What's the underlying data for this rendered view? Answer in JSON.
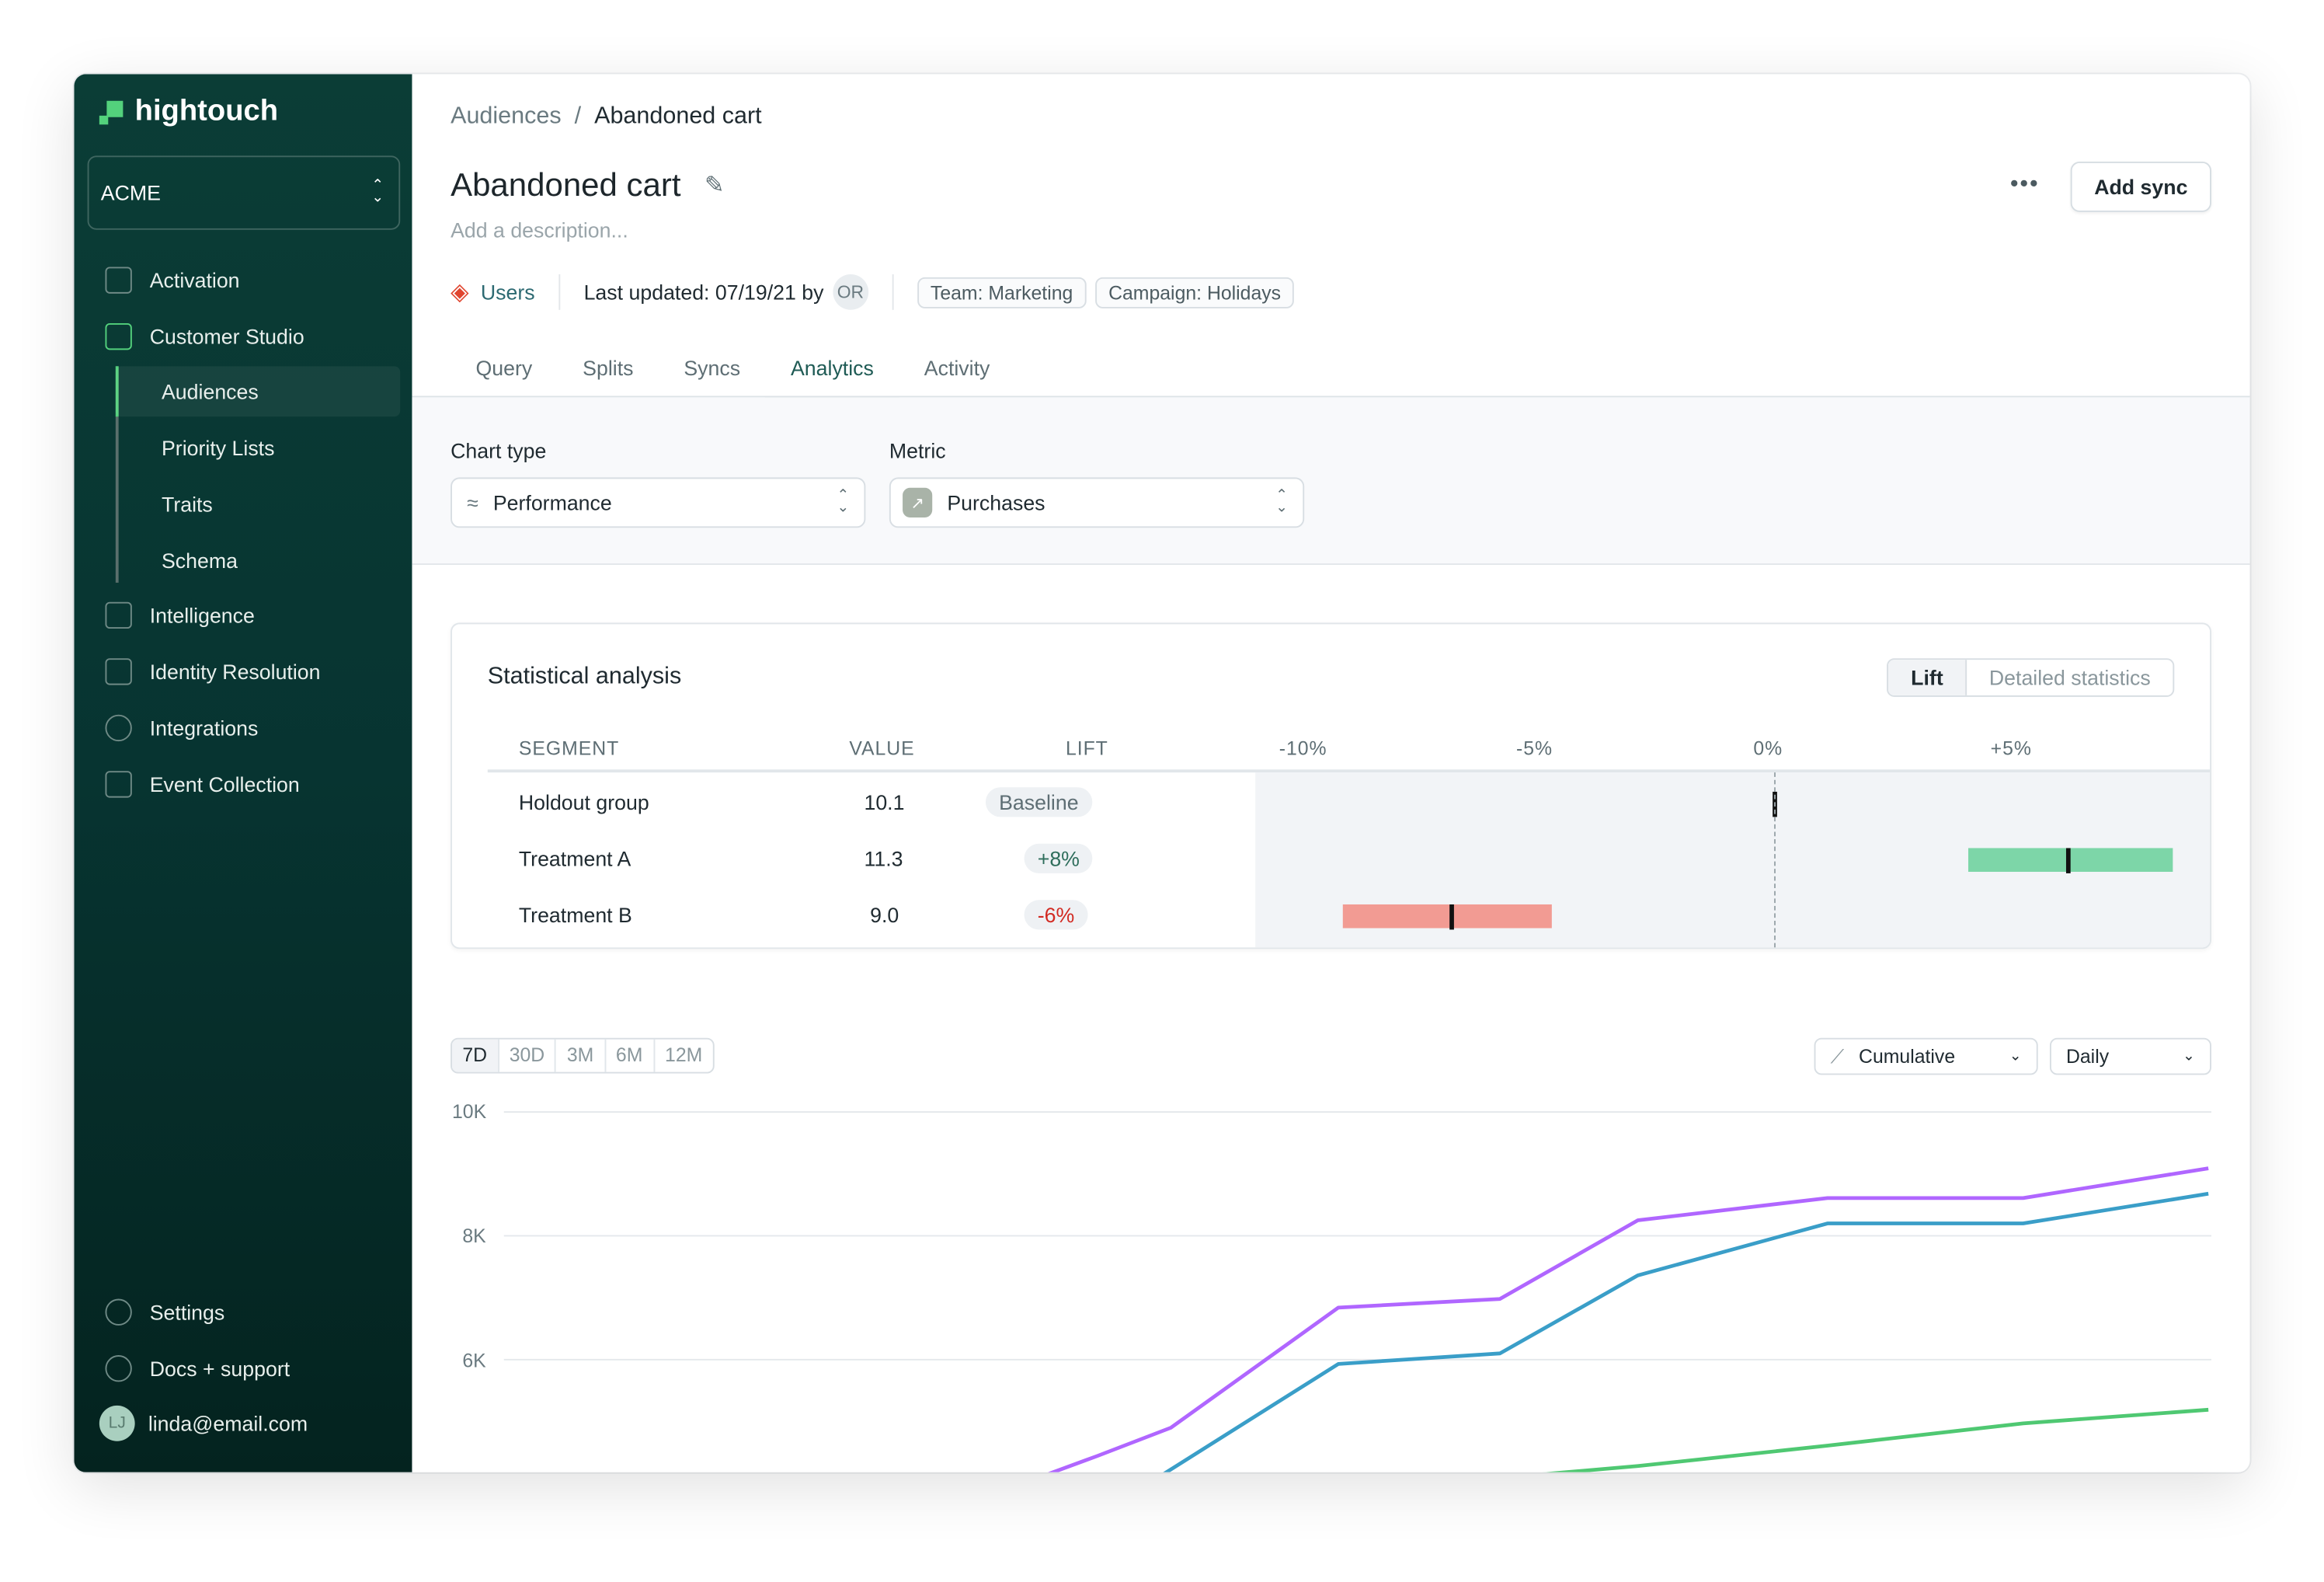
{
  "app": {
    "brand": "hightouch",
    "workspace": "ACME"
  },
  "sidebar": {
    "items": [
      {
        "label": "Activation",
        "icon": "activation-icon"
      },
      {
        "label": "Customer Studio",
        "icon": "customer-studio-icon"
      },
      {
        "label": "Intelligence",
        "icon": "intelligence-icon"
      },
      {
        "label": "Identity Resolution",
        "icon": "identity-icon"
      },
      {
        "label": "Integrations",
        "icon": "integrations-icon"
      },
      {
        "label": "Event Collection",
        "icon": "event-collection-icon"
      }
    ],
    "subitems": [
      {
        "label": "Audiences",
        "active": true
      },
      {
        "label": "Priority Lists"
      },
      {
        "label": "Traits"
      },
      {
        "label": "Schema"
      }
    ],
    "settings": "Settings",
    "docs": "Docs + support",
    "user": {
      "initials": "LJ",
      "email": "linda@email.com"
    }
  },
  "breadcrumb": {
    "parent": "Audiences",
    "sep": "/",
    "current": "Abandoned cart"
  },
  "header": {
    "title": "Abandoned cart",
    "description_placeholder": "Add a description...",
    "more": "•••",
    "add_sync": "Add sync",
    "model": "Users",
    "last_updated": "Last updated: 07/19/21 by",
    "author_initials": "OR",
    "tags": [
      "Team: Marketing",
      "Campaign: Holidays"
    ]
  },
  "tabs": [
    {
      "label": "Query"
    },
    {
      "label": "Splits"
    },
    {
      "label": "Syncs"
    },
    {
      "label": "Analytics",
      "active": true
    },
    {
      "label": "Activity"
    }
  ],
  "controls": {
    "chart_type_label": "Chart type",
    "chart_type": "Performance",
    "metric_label": "Metric",
    "metric": "Purchases"
  },
  "stats": {
    "title": "Statistical analysis",
    "toggle": [
      "Lift",
      "Detailed statistics"
    ],
    "toggle_active": "Lift",
    "columns": [
      "SEGMENT",
      "VALUE",
      "LIFT"
    ],
    "axis_ticks": [
      "-10%",
      "-5%",
      "0%",
      "+5%",
      "+"
    ],
    "rows": [
      {
        "segment": "Holdout group",
        "value": "10.1",
        "lift": "Baseline",
        "point": 0,
        "ci": null
      },
      {
        "segment": "Treatment A",
        "value": "11.3",
        "lift": "+8%",
        "point": 6.2,
        "ci": [
          4.1,
          8.4
        ],
        "color": "#7dd6a8"
      },
      {
        "segment": "Treatment B",
        "value": "9.0",
        "lift": "-6%",
        "point": -6.8,
        "ci": [
          -9.1,
          -4.7
        ],
        "color": "#f29b93"
      }
    ],
    "lift_colors": {
      "positive": "#2f6e5c",
      "negative": "#d22a22"
    }
  },
  "timeseries": {
    "ranges": [
      "7D",
      "30D",
      "3M",
      "6M",
      "12M"
    ],
    "active_range": "7D",
    "mode": "Cumulative",
    "interval": "Daily"
  },
  "chart_data": {
    "type": "line",
    "yticks": [
      "10K",
      "8K",
      "6K"
    ],
    "ylim": [
      4200,
      10000
    ],
    "grid": true,
    "series": [
      {
        "color": "#b066ff",
        "points": [
          [
            0,
            4000
          ],
          [
            1,
            4440
          ],
          [
            2,
            4900
          ],
          [
            3,
            6840
          ],
          [
            4,
            6980
          ],
          [
            5,
            8250
          ],
          [
            6,
            8610
          ],
          [
            7,
            8610
          ],
          [
            8,
            9090
          ]
        ]
      },
      {
        "color": "#3a9ec8",
        "points": [
          [
            1.7,
            4000
          ],
          [
            3,
            5930
          ],
          [
            4,
            6100
          ],
          [
            5,
            7360
          ],
          [
            6,
            8200
          ],
          [
            7,
            8200
          ],
          [
            8,
            8680
          ]
        ]
      },
      {
        "color": "#4fc872",
        "points": [
          [
            3.6,
            4000
          ],
          [
            5,
            4280
          ],
          [
            6,
            4610
          ],
          [
            7,
            4970
          ],
          [
            8,
            5190
          ]
        ]
      }
    ]
  }
}
